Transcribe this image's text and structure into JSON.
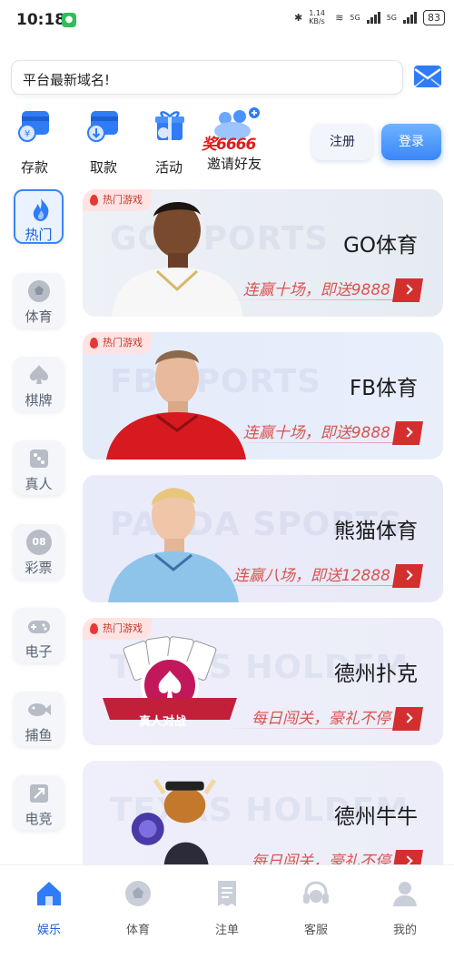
{
  "status_bar": {
    "time": "10:18",
    "speed": "1.14 KB/s",
    "net1": "5G",
    "net2": "5G",
    "battery": "83"
  },
  "notice": {
    "text": "平台最新域名!"
  },
  "quick": [
    {
      "label": "存款",
      "icon": "deposit-wallet-icon"
    },
    {
      "label": "取款",
      "icon": "withdraw-card-icon"
    },
    {
      "label": "活动",
      "icon": "gift-icon"
    },
    {
      "label": "邀请好友",
      "icon": "invite-friends-icon",
      "badge": "奖6666"
    }
  ],
  "auth": {
    "register": "注册",
    "login": "登录"
  },
  "categories": [
    {
      "label": "热门",
      "icon": "flame-icon",
      "active": true
    },
    {
      "label": "体育",
      "icon": "football-icon"
    },
    {
      "label": "棋牌",
      "icon": "spade-icon"
    },
    {
      "label": "真人",
      "icon": "dice-icon"
    },
    {
      "label": "彩票",
      "icon": "lottery-ball-icon",
      "ball_text": "08"
    },
    {
      "label": "电子",
      "icon": "gamepad-icon"
    },
    {
      "label": "捕鱼",
      "icon": "fish-icon"
    },
    {
      "label": "电竞",
      "icon": "esports-icon"
    }
  ],
  "cards": [
    {
      "hot": "热门游戏",
      "watermark": "GO SPORTS",
      "title": "GO体育",
      "promo": "连赢十场，即送9888",
      "art": "football-player-white-kit"
    },
    {
      "hot": "热门游戏",
      "watermark": "FB SPORTS",
      "title": "FB体育",
      "promo": "连赢十场，即送9888",
      "art": "football-player-red-kit"
    },
    {
      "watermark": "PANDA SPORTS",
      "title": "熊猫体育",
      "promo": "连赢八场，即送12888",
      "art": "football-player-blue-kit"
    },
    {
      "hot": "热门游戏",
      "watermark": "TEXAS HOLDEM",
      "title": "德州扑克",
      "promo": "每日闯关，豪礼不停",
      "art": "poker-cards-chip",
      "art_label": "真人对战"
    },
    {
      "watermark": "TEXAS HOLDEM",
      "title": "德州牛牛",
      "promo": "每日闯关，豪礼不停",
      "art": "cartoon-bull-chips"
    }
  ],
  "nav": [
    {
      "label": "娱乐",
      "icon": "home-icon",
      "active": true
    },
    {
      "label": "体育",
      "icon": "ball-icon"
    },
    {
      "label": "注单",
      "icon": "receipt-icon"
    },
    {
      "label": "客服",
      "icon": "headset-icon"
    },
    {
      "label": "我的",
      "icon": "user-icon"
    }
  ],
  "colors": {
    "primary": "#3a86f8",
    "promo_red": "#d32f2f",
    "hot_bg": "#ffe3e3"
  }
}
